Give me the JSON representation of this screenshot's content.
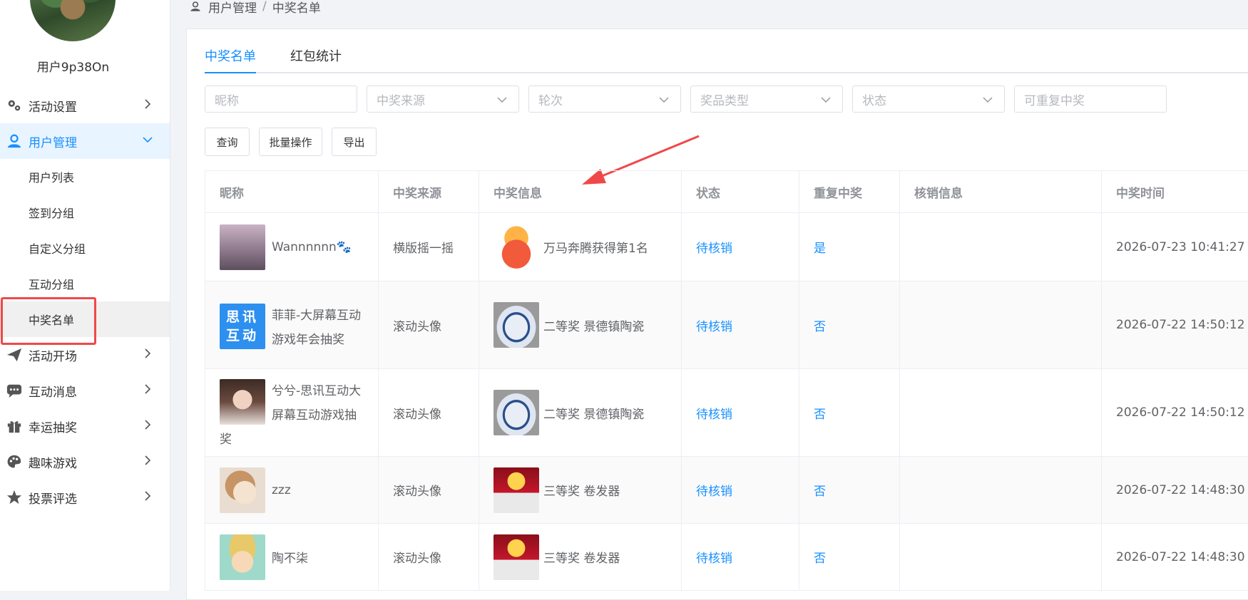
{
  "sidebar": {
    "username": "用户9p38On",
    "menu": [
      {
        "label": "活动设置",
        "icon": "gears-icon"
      },
      {
        "label": "用户管理",
        "icon": "user-manage-icon"
      },
      {
        "label": "活动开场",
        "icon": "paper-plane-icon"
      },
      {
        "label": "互动消息",
        "icon": "chat-icon"
      },
      {
        "label": "幸运抽奖",
        "icon": "gift-icon"
      },
      {
        "label": "趣味游戏",
        "icon": "palette-icon"
      },
      {
        "label": "投票评选",
        "icon": "star-icon"
      }
    ],
    "submenu": [
      "用户列表",
      "签到分组",
      "自定义分组",
      "互动分组",
      "中奖名单"
    ]
  },
  "breadcrumb": {
    "parent": "用户管理",
    "sep": "/",
    "current": "中奖名单"
  },
  "tabs": [
    "中奖名单",
    "红包统计"
  ],
  "filters": {
    "nickname": "昵称",
    "source": "中奖来源",
    "round": "轮次",
    "prize_type": "奖品类型",
    "status": "状态",
    "repeat": "可重复中奖"
  },
  "buttons": {
    "query": "查询",
    "batch": "批量操作",
    "export": "导出"
  },
  "table": {
    "headers": [
      "昵称",
      "中奖来源",
      "中奖信息",
      "状态",
      "重复中奖",
      "核销信息",
      "中奖时间"
    ],
    "rows": [
      {
        "nickname": "Wannnnnn🐾",
        "source": "横版摇一摇",
        "prize": "万马奔腾获得第1名",
        "status": "待核销",
        "repeat": "是",
        "verify": "",
        "time": "2026-07-23 10:41:27"
      },
      {
        "nickname": "菲菲-大屏幕互动游戏年会抽奖",
        "source": "滚动头像",
        "prize": "二等奖 景德镇陶瓷",
        "status": "待核销",
        "repeat": "否",
        "verify": "",
        "time": "2026-07-22 14:50:12",
        "avatar_text": "思讯互动"
      },
      {
        "nickname": "兮兮-思讯互动大屏幕互动游戏抽奖",
        "source": "滚动头像",
        "prize": "二等奖 景德镇陶瓷",
        "status": "待核销",
        "repeat": "否",
        "verify": "",
        "time": "2026-07-22 14:50:12"
      },
      {
        "nickname": "zzz",
        "source": "滚动头像",
        "prize": "三等奖 卷发器",
        "status": "待核销",
        "repeat": "否",
        "verify": "",
        "time": "2026-07-22 14:48:30"
      },
      {
        "nickname": "陶不柒",
        "source": "滚动头像",
        "prize": "三等奖 卷发器",
        "status": "待核销",
        "repeat": "否",
        "verify": "",
        "time": "2026-07-22 14:48:30"
      }
    ]
  },
  "colors": {
    "accent": "#1890ff",
    "highlight_box": "#f04848",
    "arrow": "#f04848"
  }
}
